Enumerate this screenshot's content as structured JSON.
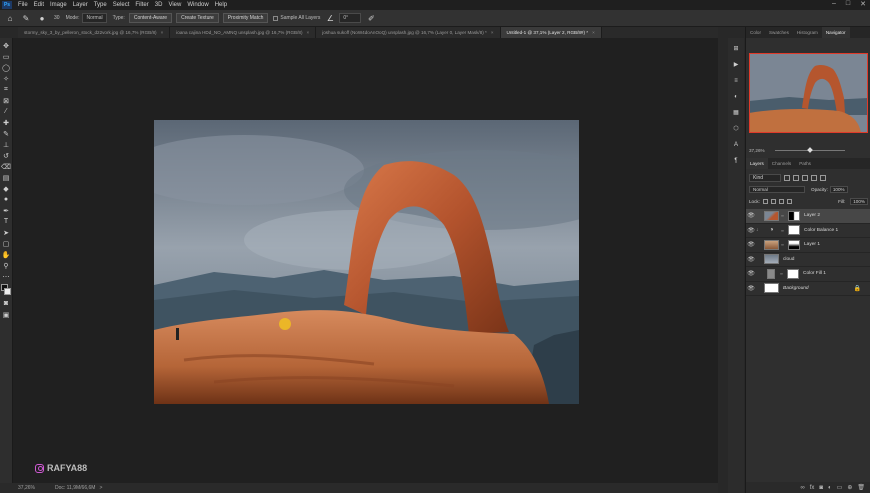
{
  "menubar": {
    "logo": "Ps",
    "items": [
      "File",
      "Edit",
      "Image",
      "Layer",
      "Type",
      "Select",
      "Filter",
      "3D",
      "View",
      "Window",
      "Help"
    ],
    "window_controls": [
      "–",
      "□",
      "✕"
    ]
  },
  "options": {
    "brush_size": "30",
    "mode_label": "Mode:",
    "mode_value": "Normal",
    "type_label": "Type:",
    "content_aware": "Content-Aware",
    "create_texture": "Create Texture",
    "proximity_match": "Proximity Match",
    "sample_all_layers": "Sample All Layers",
    "angle_value": "0°"
  },
  "tabs": [
    {
      "label": "stormy_sky_3_by_pelleron_stock_d22vork.jpg @ 16,7% (RGB/8)"
    },
    {
      "label": "ioana cajina HDd_NO_AMNQ unsplash.jpg @ 16,7% (RGB/8)"
    },
    {
      "label": "joshua sukoff (NoW4doAnOoQ) unsplash.jpg @ 16,7% (Layer 0, Layer Mask/8) *"
    },
    {
      "label": "Untitled-1 @ 37,1% (Layer 2, RGB/8#) *"
    }
  ],
  "status": {
    "zoom": "37,26%",
    "doc": "Doc: 11,9M/66,6M",
    "arrow": ">"
  },
  "watermark": {
    "text": "RAFYA88"
  },
  "panels": {
    "top_tabs": [
      "Color",
      "Swatches",
      "Histogram",
      "Navigator"
    ],
    "active_top_tab": "Navigator",
    "nav_zoom": "37,26%",
    "layer_tabs": [
      "Layers",
      "Channels",
      "Paths"
    ],
    "kind_label": "Kind",
    "blend_mode": "Normal",
    "opacity_label": "Opacity:",
    "opacity_value": "100%",
    "lock_label": "Lock:",
    "fill_label": "Fill:",
    "fill_value": "100%"
  },
  "layers": [
    {
      "name": "Layer 2",
      "selected": true,
      "thumb": "arch",
      "mask": "black-white",
      "clip": ""
    },
    {
      "name": "Color Balance 1",
      "selected": false,
      "thumb": "adjust",
      "mask": "white",
      "clip": "↓"
    },
    {
      "name": "Layer 1",
      "selected": false,
      "thumb": "sand",
      "mask": "gradient",
      "clip": ""
    },
    {
      "name": "cloud",
      "selected": false,
      "thumb": "cloud",
      "mask": "",
      "clip": ""
    },
    {
      "name": "Color Fill 1",
      "selected": false,
      "thumb": "fill",
      "mask": "white",
      "clip": ""
    },
    {
      "name": "Background",
      "selected": false,
      "thumb": "white",
      "mask": "",
      "clip": "",
      "locked": true
    }
  ],
  "colors": {
    "nav_frame": "#e03a2a",
    "selected_layer": "#474747",
    "watermark_icon": "#d05ad4"
  }
}
